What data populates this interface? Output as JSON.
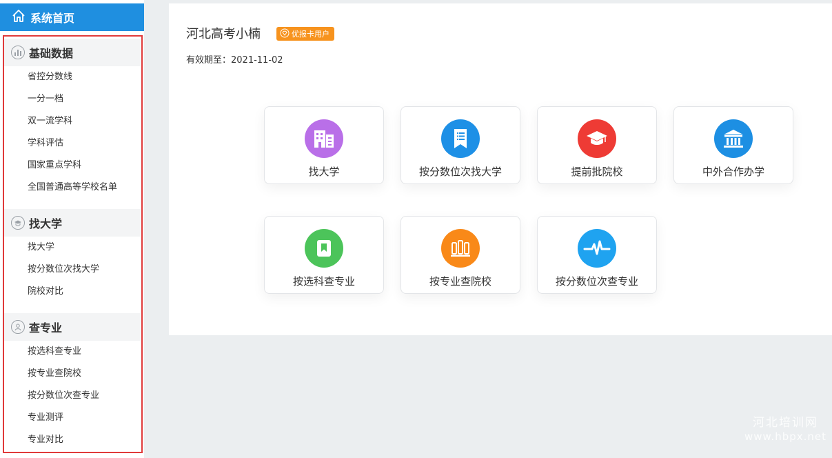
{
  "sidebar": {
    "home": {
      "label": "系统首页",
      "icon": "home-icon"
    },
    "groups": [
      {
        "title": "基础数据",
        "icon": "chart-icon",
        "items": [
          "省控分数线",
          "一分一档",
          "双一流学科",
          "学科评估",
          "国家重点学科",
          "全国普通高等学校名单"
        ]
      },
      {
        "title": "找大学",
        "icon": "graduation-cap-icon",
        "items": [
          "找大学",
          "按分数位次找大学",
          "院校对比"
        ]
      },
      {
        "title": "查专业",
        "icon": "user-icon",
        "items": [
          "按选科查专业",
          "按专业查院校",
          "按分数位次查专业",
          "专业测评",
          "专业对比"
        ]
      }
    ]
  },
  "user": {
    "name": "河北高考小楠",
    "badge": "优报卡用户",
    "valid_label": "有效期至：",
    "valid_date": "2021-11-02"
  },
  "tiles": [
    {
      "label": "找大学",
      "icon": "building-icon",
      "color": "#b96fe8"
    },
    {
      "label": "按分数位次找大学",
      "icon": "document-list-icon",
      "color": "#1e90e6"
    },
    {
      "label": "提前批院校",
      "icon": "graduation-cap-icon",
      "color": "#ee3b35"
    },
    {
      "label": "中外合作办学",
      "icon": "institution-icon",
      "color": "#1d8fe3"
    },
    {
      "label": "按选科查专业",
      "icon": "bookmark-icon",
      "color": "#4cc45a"
    },
    {
      "label": "按专业查院校",
      "icon": "books-icon",
      "color": "#f98918"
    },
    {
      "label": "按分数位次查专业",
      "icon": "pulse-icon",
      "color": "#1fa3f0"
    }
  ],
  "watermark": {
    "line1": "河北培训网",
    "line2": "www.hbpx.net"
  }
}
